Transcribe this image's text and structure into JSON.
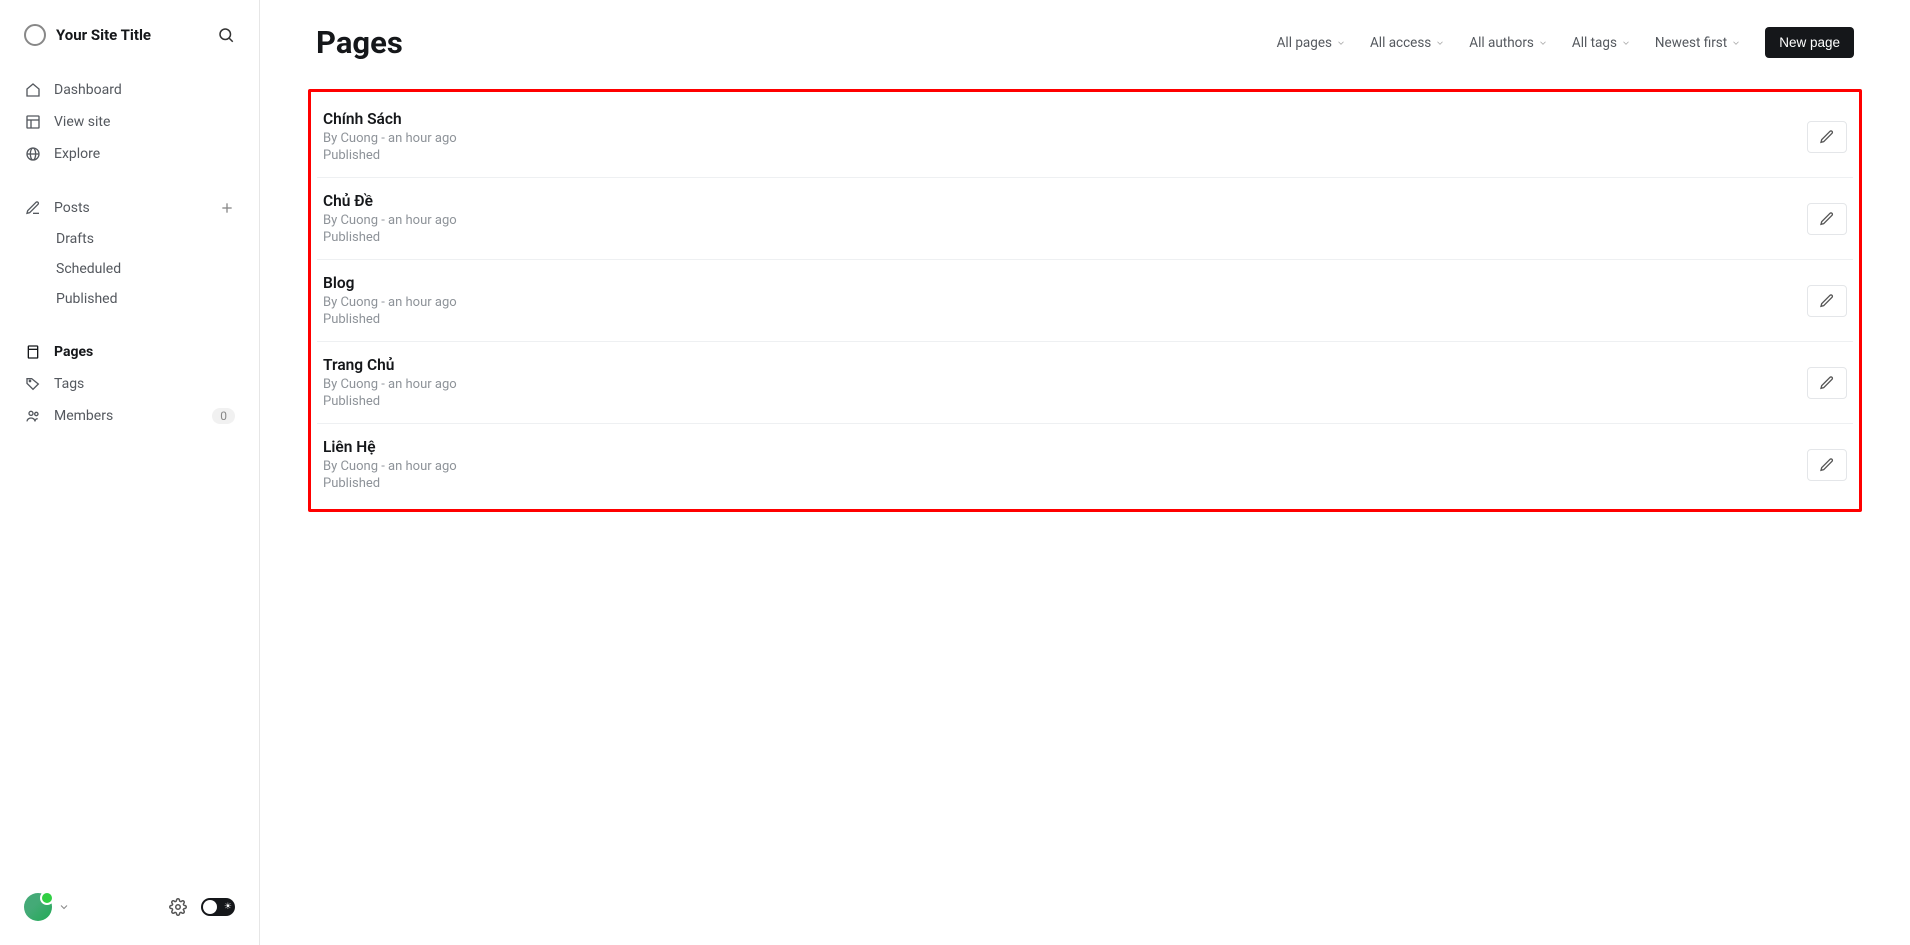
{
  "sidebar": {
    "site_title": "Your Site Title",
    "nav": {
      "dashboard": "Dashboard",
      "view_site": "View site",
      "explore": "Explore",
      "posts": "Posts",
      "drafts": "Drafts",
      "scheduled": "Scheduled",
      "published": "Published",
      "pages": "Pages",
      "tags": "Tags",
      "members": "Members",
      "members_count": "0"
    }
  },
  "header": {
    "title": "Pages",
    "filters": {
      "pages": "All pages",
      "access": "All access",
      "authors": "All authors",
      "tags": "All tags",
      "sort": "Newest first"
    },
    "new_button": "New page"
  },
  "pages": [
    {
      "title": "Chính Sách",
      "meta": "By Cuong - an hour ago",
      "status": "Published"
    },
    {
      "title": "Chủ Đề",
      "meta": "By Cuong - an hour ago",
      "status": "Published"
    },
    {
      "title": "Blog",
      "meta": "By Cuong - an hour ago",
      "status": "Published"
    },
    {
      "title": "Trang Chủ",
      "meta": "By Cuong - an hour ago",
      "status": "Published"
    },
    {
      "title": "Liên Hệ",
      "meta": "By Cuong - an hour ago",
      "status": "Published"
    }
  ]
}
